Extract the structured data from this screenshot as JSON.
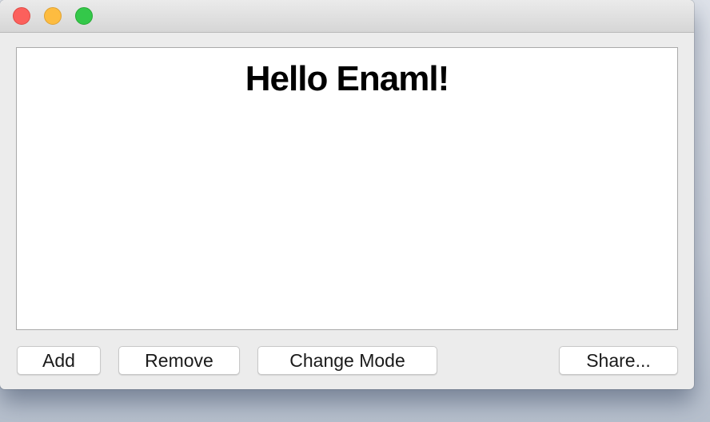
{
  "window": {
    "title": "",
    "traffic_colors": {
      "close": "#fc605c",
      "minimize": "#fdbc40",
      "maximize": "#34c84a"
    }
  },
  "content": {
    "heading": "Hello Enaml!"
  },
  "buttons": {
    "add": "Add",
    "remove": "Remove",
    "change_mode": "Change Mode",
    "share": "Share..."
  }
}
